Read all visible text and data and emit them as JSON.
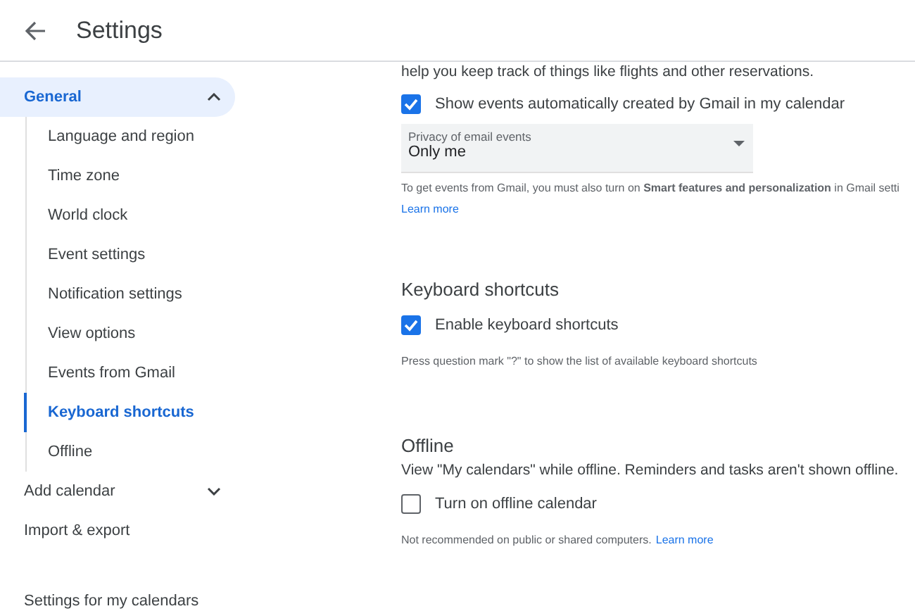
{
  "header": {
    "title": "Settings"
  },
  "sidebar": {
    "sections": [
      {
        "label": "General",
        "expanded": true,
        "selected": true,
        "children": [
          {
            "label": "Language and region",
            "selected": false
          },
          {
            "label": "Time zone",
            "selected": false
          },
          {
            "label": "World clock",
            "selected": false
          },
          {
            "label": "Event settings",
            "selected": false
          },
          {
            "label": "Notification settings",
            "selected": false
          },
          {
            "label": "View options",
            "selected": false
          },
          {
            "label": "Events from Gmail",
            "selected": false
          },
          {
            "label": "Keyboard shortcuts",
            "selected": true
          },
          {
            "label": "Offline",
            "selected": false
          }
        ]
      },
      {
        "label": "Add calendar",
        "expanded": false,
        "selected": false
      },
      {
        "label": "Import & export",
        "selected": false
      }
    ],
    "group_title": "Settings for my calendars"
  },
  "content": {
    "intro": "help you keep track of things like flights and other reservations.",
    "gmail": {
      "checkbox": {
        "label": "Show events automatically created by Gmail in my calendar",
        "checked": true
      },
      "dropdown": {
        "label": "Privacy of email events",
        "value": "Only me"
      },
      "note": "To get events from Gmail, you must also turn on **Smart features and personalization** in Gmail setti",
      "link": "Learn more"
    },
    "sections": [
      {
        "title": "Keyboard shortcuts",
        "checkbox": {
          "label": "Enable keyboard shortcuts",
          "checked": true
        },
        "note": "Press question mark \"?\" to show the list of available keyboard shortcuts"
      },
      {
        "title": "Offline",
        "description": "View \"My calendars\" while offline. Reminders and tasks aren't shown offline.",
        "checkbox": {
          "label": "Turn on offline calendar",
          "checked": false
        },
        "note": "Not recommended on public or shared computers.",
        "link": "Learn more"
      }
    ]
  }
}
